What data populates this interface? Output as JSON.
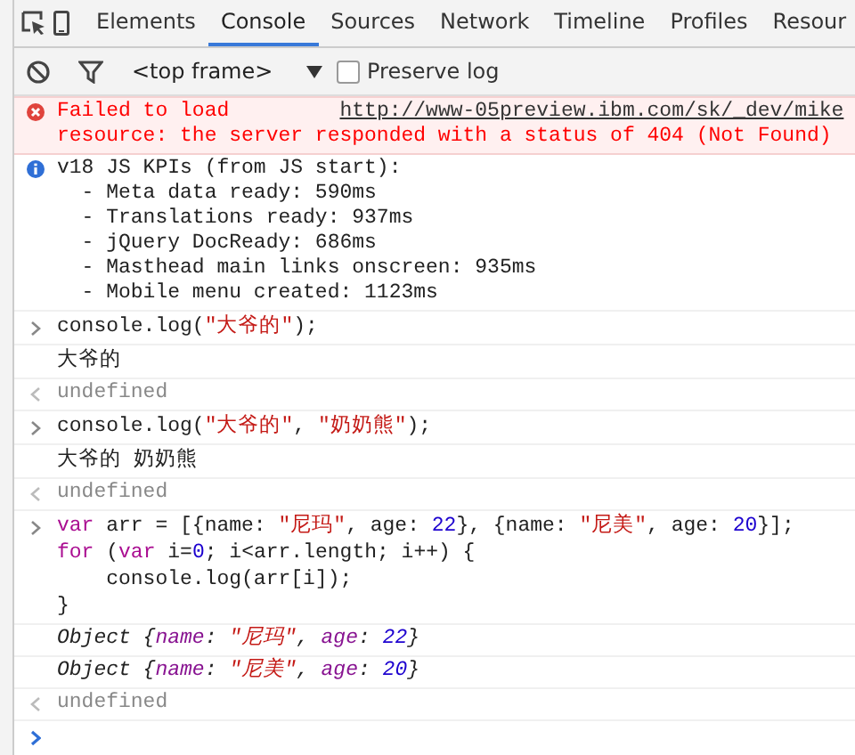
{
  "tabs": [
    {
      "label": "Elements",
      "selected": false
    },
    {
      "label": "Console",
      "selected": true
    },
    {
      "label": "Sources",
      "selected": false
    },
    {
      "label": "Network",
      "selected": false
    },
    {
      "label": "Timeline",
      "selected": false
    },
    {
      "label": "Profiles",
      "selected": false
    },
    {
      "label": "Resour",
      "selected": false
    }
  ],
  "toolbar": {
    "frame_select": "<top frame>",
    "preserve_log": {
      "label": "Preserve log",
      "checked": false
    }
  },
  "entries": [
    {
      "kind": "error",
      "lines": [
        [
          {
            "text": "Failed to load         ",
            "kind": "plain"
          },
          {
            "text": "http://www-05preview.ibm.com/sk/_dev/mike",
            "kind": "link"
          }
        ],
        [
          {
            "text": "resource: the server responded with a status of 404 (Not Found)",
            "kind": "plain"
          }
        ]
      ]
    },
    {
      "kind": "info",
      "lines": [
        [
          {
            "text": "v18 JS KPIs (from JS start):",
            "kind": "plain"
          }
        ],
        [
          {
            "text": "  - Meta data ready: 590ms",
            "kind": "plain"
          }
        ],
        [
          {
            "text": "  - Translations ready: 937ms",
            "kind": "plain"
          }
        ],
        [
          {
            "text": "  - jQuery DocReady: 686ms",
            "kind": "plain"
          }
        ],
        [
          {
            "text": "  - Masthead main links onscreen: 935ms",
            "kind": "plain"
          }
        ],
        [
          {
            "text": "  - Mobile menu created: 1123ms",
            "kind": "plain"
          }
        ]
      ]
    },
    {
      "kind": "input",
      "lines": [
        [
          {
            "text": "console.log(",
            "kind": "plain"
          },
          {
            "text": "\"大爷的\"",
            "kind": "string"
          },
          {
            "text": ");",
            "kind": "plain"
          }
        ]
      ]
    },
    {
      "kind": "log",
      "lines": [
        [
          {
            "text": "大爷的",
            "kind": "plain"
          }
        ]
      ]
    },
    {
      "kind": "result",
      "lines": [
        [
          {
            "text": "undefined",
            "kind": "plain"
          }
        ]
      ]
    },
    {
      "kind": "input",
      "lines": [
        [
          {
            "text": "console.log(",
            "kind": "plain"
          },
          {
            "text": "\"大爷的\"",
            "kind": "string"
          },
          {
            "text": ", ",
            "kind": "plain"
          },
          {
            "text": "\"奶奶熊\"",
            "kind": "string"
          },
          {
            "text": ");",
            "kind": "plain"
          }
        ]
      ]
    },
    {
      "kind": "log",
      "lines": [
        [
          {
            "text": "大爷的 奶奶熊",
            "kind": "plain"
          }
        ]
      ]
    },
    {
      "kind": "result",
      "lines": [
        [
          {
            "text": "undefined",
            "kind": "plain"
          }
        ]
      ]
    },
    {
      "kind": "input",
      "lines": [
        [
          {
            "text": "var",
            "kind": "keyword"
          },
          {
            "text": " arr = [{name: ",
            "kind": "plain"
          },
          {
            "text": "\"尼玛\"",
            "kind": "string"
          },
          {
            "text": ", age: ",
            "kind": "plain"
          },
          {
            "text": "22",
            "kind": "number"
          },
          {
            "text": "}, {name: ",
            "kind": "plain"
          },
          {
            "text": "\"尼美\"",
            "kind": "string"
          },
          {
            "text": ", age: ",
            "kind": "plain"
          },
          {
            "text": "20",
            "kind": "number"
          },
          {
            "text": "}];",
            "kind": "plain"
          }
        ],
        [
          {
            "text": "for",
            "kind": "keyword"
          },
          {
            "text": " (",
            "kind": "plain"
          },
          {
            "text": "var",
            "kind": "keyword"
          },
          {
            "text": " i=",
            "kind": "plain"
          },
          {
            "text": "0",
            "kind": "number"
          },
          {
            "text": "; i<arr.length; i++) {",
            "kind": "plain"
          }
        ],
        [
          {
            "text": "    console.log(arr[i]);",
            "kind": "plain"
          }
        ],
        [
          {
            "text": "}",
            "kind": "plain"
          }
        ]
      ]
    },
    {
      "kind": "object",
      "lines": [
        [
          {
            "text": "Object {",
            "kind": "plain"
          },
          {
            "text": "name",
            "kind": "prop"
          },
          {
            "text": ": ",
            "kind": "plain"
          },
          {
            "text": "\"尼玛\"",
            "kind": "string"
          },
          {
            "text": ", ",
            "kind": "plain"
          },
          {
            "text": "age",
            "kind": "prop"
          },
          {
            "text": ": ",
            "kind": "plain"
          },
          {
            "text": "22",
            "kind": "number"
          },
          {
            "text": "}",
            "kind": "plain"
          }
        ]
      ]
    },
    {
      "kind": "object",
      "lines": [
        [
          {
            "text": "Object {",
            "kind": "plain"
          },
          {
            "text": "name",
            "kind": "prop"
          },
          {
            "text": ": ",
            "kind": "plain"
          },
          {
            "text": "\"尼美\"",
            "kind": "string"
          },
          {
            "text": ", ",
            "kind": "plain"
          },
          {
            "text": "age",
            "kind": "prop"
          },
          {
            "text": ": ",
            "kind": "plain"
          },
          {
            "text": "20",
            "kind": "number"
          },
          {
            "text": "}",
            "kind": "plain"
          }
        ]
      ]
    },
    {
      "kind": "result",
      "lines": [
        [
          {
            "text": "undefined",
            "kind": "plain"
          }
        ]
      ]
    }
  ]
}
